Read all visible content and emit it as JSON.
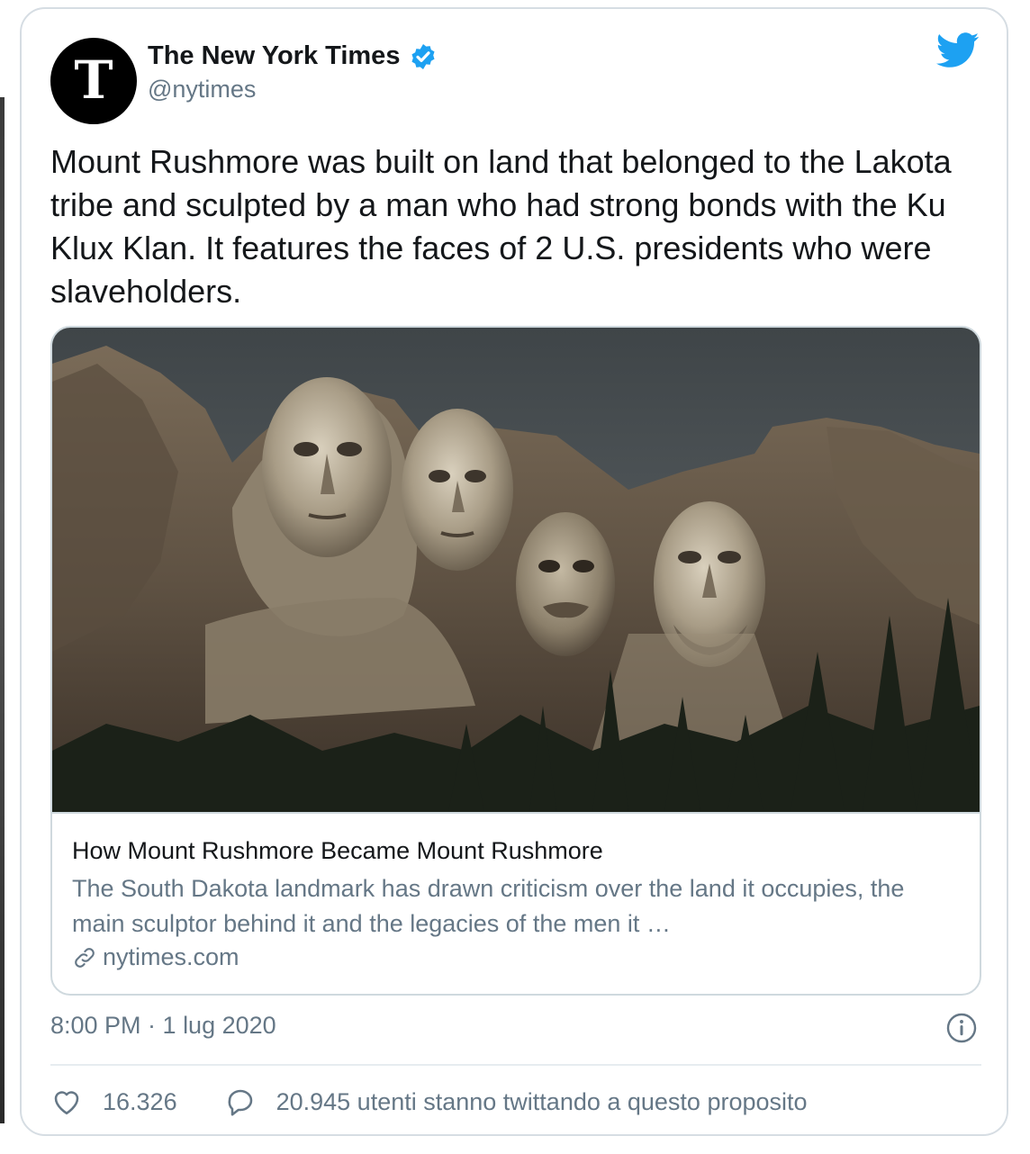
{
  "account": {
    "name": "The New York Times",
    "handle": "@nytimes"
  },
  "tweet": {
    "text": "Mount Rushmore was built on land that belonged to the Lakota tribe and sculpted by a man who had strong bonds with the Ku Klux Klan. It features the faces of 2 U.S. presidents who were slaveholders."
  },
  "link_card": {
    "title": "How Mount Rushmore Became Mount Rushmore",
    "description": "The South Dakota landmark has drawn criticism over the land it occupies, the main sculptor behind it and the legacies of the men it …",
    "domain": "nytimes.com"
  },
  "meta": {
    "timestamp": "8:00 PM · 1 lug 2020"
  },
  "stats": {
    "likes": "16.326",
    "replies": "20.945 utenti stanno twittando a questo proposito"
  },
  "colors": {
    "twitter_blue": "#1da1f2",
    "text_primary": "#14171a",
    "text_secondary": "#657786",
    "border": "#d6dde3"
  }
}
